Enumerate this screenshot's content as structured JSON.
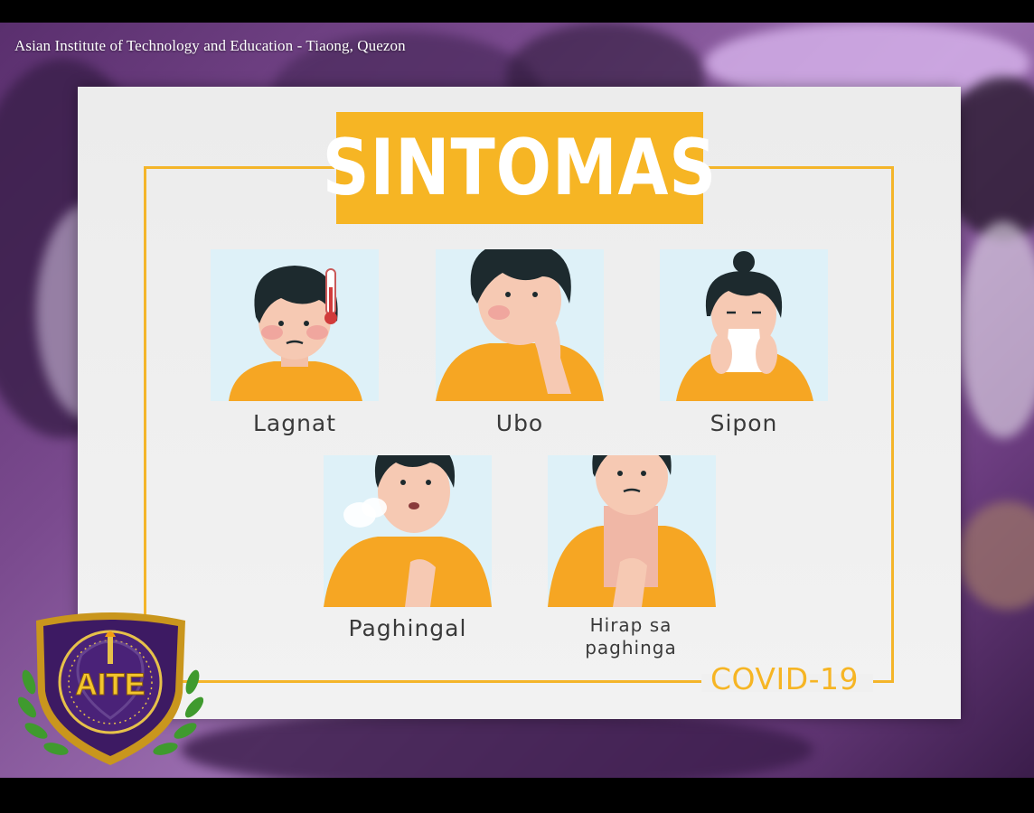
{
  "header": {
    "title": "Asian Institute of Technology and Education - Tiaong, Quezon"
  },
  "poster": {
    "heading": "SINTOMAS",
    "footer": "COVID-19",
    "symptoms": [
      {
        "label": "Lagnat",
        "icon": "fever-thermometer-icon"
      },
      {
        "label": "Ubo",
        "icon": "cough-icon"
      },
      {
        "label": "Sipon",
        "icon": "runny-nose-icon"
      },
      {
        "label": "Paghingal",
        "icon": "shortness-of-breath-icon"
      },
      {
        "label_line1": "Hirap sa",
        "label_line2": "paghinga",
        "icon": "difficulty-breathing-icon"
      }
    ]
  },
  "logo": {
    "text": "AITE"
  },
  "colors": {
    "accent": "#f6b524",
    "card_bg": "#def1f8",
    "shirt": "#f6a623",
    "hair": "#1d2a2e",
    "purple": "#5a2f6e"
  }
}
